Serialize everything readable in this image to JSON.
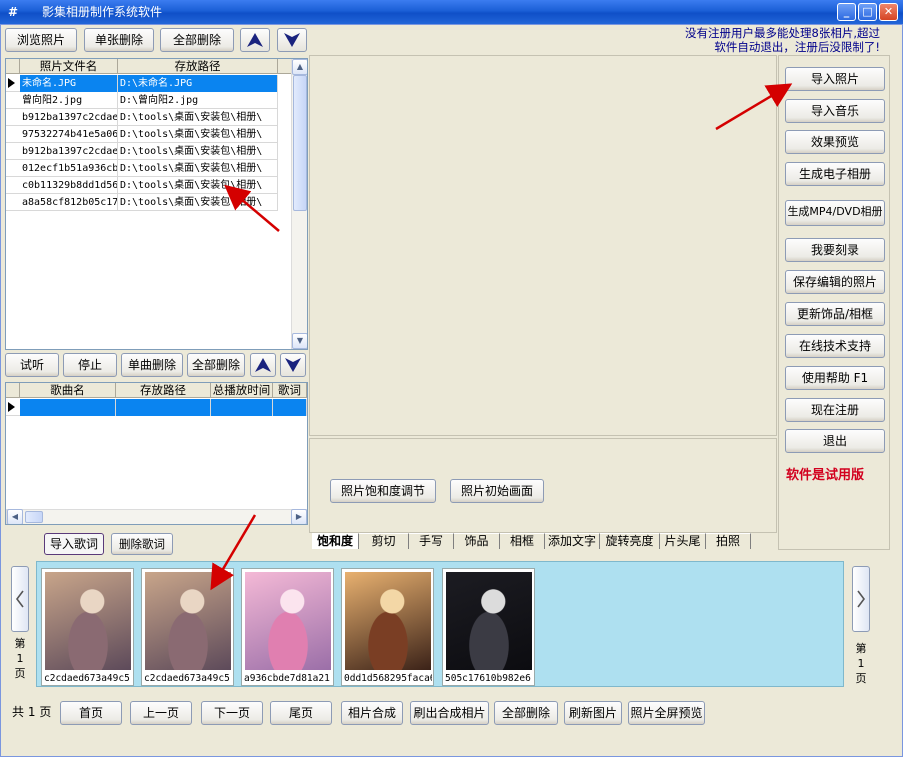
{
  "window": {
    "title": "影集相册制作系统软件",
    "controls": [
      "_",
      "□",
      "✕"
    ]
  },
  "toolbar": {
    "browse": "浏览照片",
    "delete_one": "单张删除",
    "delete_all": "全部删除"
  },
  "notice": {
    "line1": "没有注册用户最多能处理8张相片,超过",
    "line2": "软件自动退出，注册后没限制了!"
  },
  "photo_grid": {
    "headers": [
      "照片文件名",
      "存放路径"
    ],
    "rows": [
      [
        "未命名.JPG",
        "D:\\未命名.JPG"
      ],
      [
        "曾向阳2.jpg",
        "D:\\曾向阳2.jpg"
      ],
      [
        "b912ba1397c2cdae",
        "D:\\tools\\桌面\\安装包\\相册\\"
      ],
      [
        "97532274b41e5a06",
        "D:\\tools\\桌面\\安装包\\相册\\"
      ],
      [
        "b912ba1397c2cdae",
        "D:\\tools\\桌面\\安装包\\相册\\"
      ],
      [
        "012ecf1b51a936cb",
        "D:\\tools\\桌面\\安装包\\相册\\"
      ],
      [
        "c0b11329b8dd1d56",
        "D:\\tools\\桌面\\安装包\\相册\\"
      ],
      [
        "a8a58cf812b05c17",
        "D:\\tools\\桌面\\安装包\\相册\\"
      ]
    ],
    "selected_row": 0
  },
  "music_controls": {
    "listen": "试听",
    "stop": "停止",
    "delete_one": "单曲删除",
    "delete_all": "全部删除"
  },
  "music_grid": {
    "headers": [
      "歌曲名",
      "存放路径",
      "总播放时间",
      "歌词"
    ]
  },
  "lyrics": {
    "import": "导入歌词",
    "delete": "删除歌词"
  },
  "adjust": {
    "saturation": "照片饱和度调节",
    "initial": "照片初始画面"
  },
  "tabs": [
    "饱和度",
    "剪切",
    "手写",
    "饰品",
    "相框",
    "添加文字",
    "旋转亮度",
    "片头尾",
    "拍照"
  ],
  "active_tab": 0,
  "right_buttons": [
    "导入照片",
    "导入音乐",
    "效果预览",
    "生成电子相册",
    "生成MP4/DVD相册",
    "我要刻录",
    "保存编辑的照片",
    "更新饰品/相框",
    "在线技术支持",
    "使用帮助  F1",
    "现在注册",
    "退出"
  ],
  "trial_text": "软件是试用版",
  "thumbnails": [
    {
      "caption": "c2cdaed673a49c5",
      "icon": "anime-photo-1"
    },
    {
      "caption": "c2cdaed673a49c5",
      "icon": "anime-photo-1"
    },
    {
      "caption": "a936cbde7d81a21",
      "icon": "anime-photo-pink"
    },
    {
      "caption": "0dd1d568295faca6",
      "icon": "anime-photo-amber"
    },
    {
      "caption": "505c17610b982e6",
      "icon": "anime-photo-dark"
    }
  ],
  "pager": {
    "left": [
      "第",
      "1",
      "页"
    ],
    "right": [
      "第",
      "1",
      "页"
    ],
    "total_prefix": "共",
    "total_count": "1",
    "total_suffix": "页"
  },
  "bottom_buttons": [
    "首页",
    "上一页",
    "下一页",
    "尾页",
    "相片合成",
    "刷出合成相片",
    "全部删除",
    "刷新图片",
    "照片全屏预览"
  ]
}
